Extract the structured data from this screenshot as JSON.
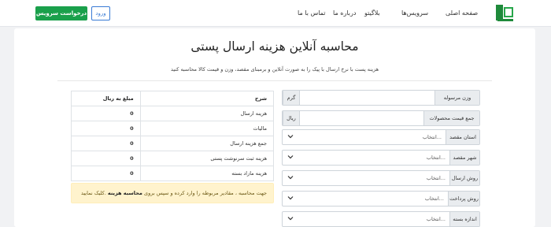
{
  "navbar": {
    "links": [
      "صفحه اصلی",
      "سرویس‌ها",
      "بلاگیتو",
      "درباره ما",
      "تماس با ما"
    ],
    "service_button": "درخواست سرویس",
    "login_button": "ورود",
    "colors": {
      "accent": "#1aa04b",
      "login": "#3a7bd5"
    }
  },
  "main": {
    "title": "محاسبه آنلاین هزینه ارسال پستی",
    "subtitle": "هزینه پست با نرخ ارسال با پیک را به صورت آنلاین و برمبنای مقصد، وزن و قیمت کالا محاسبه کنید"
  },
  "form": {
    "weight": {
      "label": "وزن مرسوله",
      "unit": "گرم"
    },
    "total": {
      "label": "جمع قیمت محصولات",
      "unit": "ریال"
    },
    "dest_province": {
      "label": "استان مقصد",
      "value": "انتخاب..."
    },
    "dest_city": {
      "label": "شهر مقصد",
      "value": "انتخاب..."
    },
    "shipping_method": {
      "label": "روش ارسال",
      "value": "انتخاب..."
    },
    "payment_method": {
      "label": "روش پرداخت",
      "value": "انتخاب..."
    },
    "package_size": {
      "label": "اندازه بسته",
      "value": "انتخاب..."
    }
  },
  "table": {
    "headers": {
      "desc": "شرح",
      "amount": "مبلغ به ریال"
    },
    "rows": [
      {
        "desc": "هزینه ارسال",
        "amount": "0"
      },
      {
        "desc": "مالیات",
        "amount": "0"
      },
      {
        "desc": "جمع هزینه ارسال",
        "amount": "0"
      },
      {
        "desc": "هزینه ثبت سرنوشت پستی",
        "amount": "0"
      },
      {
        "desc": "هزینه مازاد بسته",
        "amount": "0"
      }
    ]
  },
  "alert": {
    "text_before": "جهت محاسبه ، مقادیر مربوطه را وارد کرده و سپس بروی",
    "bold": "محاسبه هزینه",
    "text_after": "کلیک نمایید."
  }
}
